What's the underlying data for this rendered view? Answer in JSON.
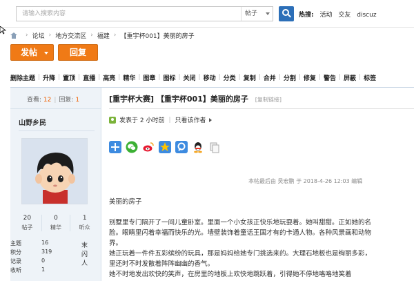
{
  "search": {
    "placeholder": "请输入搜索内容",
    "type_selected": "帖子"
  },
  "hot": {
    "label": "热搜:",
    "links": [
      "活动",
      "交友",
      "discuz"
    ]
  },
  "breadcrumb": [
    "论坛",
    "地方交流区",
    "福建",
    "【重宇杯001】美丽的房子"
  ],
  "buttons": {
    "post": "发帖",
    "reply": "回复"
  },
  "mod_toolbar": [
    "删除主题",
    "升降",
    "置顶",
    "直播",
    "高亮",
    "精华",
    "图章",
    "图标",
    "关闭",
    "移动",
    "分类",
    "复制",
    "合并",
    "分割",
    "修复",
    "警告",
    "屏蔽",
    "标签"
  ],
  "thread_stats": {
    "views_label": "查看:",
    "views": "12",
    "replies_label": "回复:",
    "replies": "1"
  },
  "author": {
    "name": "山野乡民",
    "stats": [
      {
        "value": "20",
        "label": "帖子"
      },
      {
        "value": "0",
        "label": "精华"
      },
      {
        "value": "1",
        "label": "听众"
      }
    ],
    "info": [
      {
        "key": "主题",
        "value": "16"
      },
      {
        "key": "积分",
        "value": "319"
      },
      {
        "key": "记录",
        "value": "0"
      },
      {
        "key": "收听",
        "value": "1"
      }
    ],
    "side_chars": [
      "末",
      "闪",
      "人"
    ]
  },
  "post": {
    "title": "[重宇杯大赛] 【重宇杯001】美丽的房子",
    "copy_link": "[复制链接]",
    "posted": "发表于 2 小时前",
    "only_author": "只看该作者",
    "edit_note": "本帖最后由 吴宏鹏 于 2018-4-26 12:03 编辑",
    "body_title": "美丽的房子",
    "paragraphs": [
      "别墅里专门隔开了一间儿童卧室。里面一个小女孩正快乐地玩耍着。她叫甜甜。正如她的名",
      "脸。眼睛里闪着幸福而快乐的光。墙壁装饰着童话王国才有的卡通人物。各种风景画和动物",
      "界。",
      "她正玩着一件件五彩缤纷的玩具，那是妈妈给她专门挑选来的。大理石地板也是绚丽多彩，",
      "里还时不时发散着阵阵幽幽的香气。",
      "她不时地发出欢快的笑声，在房里的地板上欢快地跳跃着，引得她不停地咯咯地笑着"
    ]
  },
  "colors": {
    "accent": "#f07a16",
    "search_button": "#2c6fb8",
    "panel_bg": "#eef3f8",
    "views_number": "#f06000"
  }
}
